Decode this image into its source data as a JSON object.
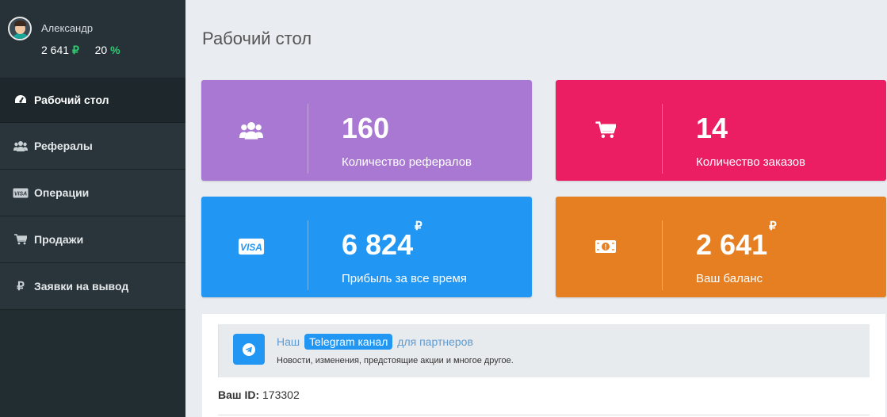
{
  "user": {
    "name": "Александр",
    "balance": "2 641",
    "balance_currency": "₽",
    "percent": "20",
    "percent_sign": "%"
  },
  "sidebar": {
    "items": [
      {
        "label": "Рабочий стол",
        "icon": "dashboard-icon",
        "active": true
      },
      {
        "label": "Рефералы",
        "icon": "users-icon"
      },
      {
        "label": "Операции",
        "icon": "visa-icon"
      },
      {
        "label": "Продажи",
        "icon": "cart-icon"
      },
      {
        "label": "Заявки на вывод",
        "icon": "ruble-icon"
      }
    ]
  },
  "page": {
    "title": "Рабочий стол"
  },
  "cards": [
    {
      "value": "160",
      "label": "Количество рефералов",
      "color": "#a878d2",
      "icon": "users-icon"
    },
    {
      "value": "14",
      "label": "Количество заказов",
      "color": "#eb1e63",
      "icon": "cart-icon"
    },
    {
      "value": "6 824",
      "currency": "₽",
      "label": "Прибыль за все время",
      "color": "#2196f3",
      "icon": "visa-icon"
    },
    {
      "value": "2 641",
      "currency": "₽",
      "label": "Ваш баланс",
      "color": "#e67e22",
      "icon": "money-icon"
    }
  ],
  "notice": {
    "prefix": "Наш",
    "link": "Telegram канал",
    "suffix": "для партнеров",
    "text": "Новости, изменения, предстоящие акции и многое другое."
  },
  "account": {
    "id_label": "Ваш ID:",
    "id_value": "173302"
  },
  "colors": {
    "sidebar_bg": "#222d32",
    "accent_green": "#2ecc71",
    "telegram_blue": "#2196f3"
  }
}
